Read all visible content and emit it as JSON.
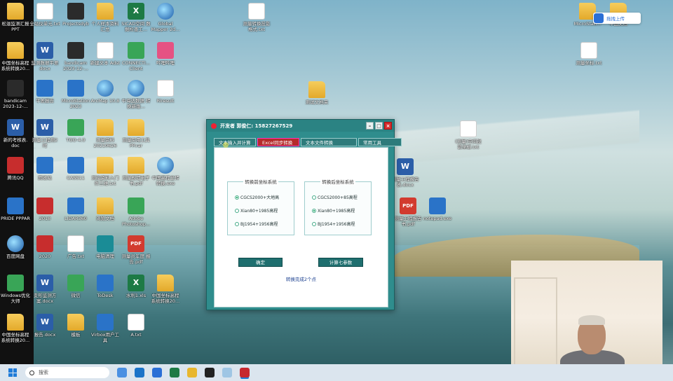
{
  "desktop": {
    "icons": [
      {
        "label": "松滋监测汇报 PPT",
        "kind": "folder"
      },
      {
        "label": "中国坐标高程 系统转换20...",
        "kind": "folder"
      },
      {
        "label": "bandicam 2023-12-...",
        "kind": "dark"
      },
      {
        "label": "新的考核表. doc",
        "kind": "word"
      },
      {
        "label": "腾讯QQ",
        "kind": "red"
      },
      {
        "label": "PRIDE PPPAR",
        "kind": "blue"
      },
      {
        "label": "百度网盘",
        "kind": "globe"
      },
      {
        "label": "Windows优化大师",
        "kind": "green"
      },
      {
        "label": "中国坐标高程 系统转换20...",
        "kind": "folder"
      },
      {
        "label": "全站仪单元.txt",
        "kind": "doc"
      },
      {
        "label": "监测数据平差 docx",
        "kind": "word"
      },
      {
        "label": "平差报告",
        "kind": "blue"
      },
      {
        "label": "测量工程测2 时间.213.docx",
        "kind": "word"
      },
      {
        "label": "回收站",
        "kind": "blue"
      },
      {
        "label": "2018",
        "kind": "red"
      },
      {
        "label": "2020",
        "kind": "red"
      },
      {
        "label": "变形监测方 案.docx",
        "kind": "word"
      },
      {
        "label": "报告.docx",
        "kind": "word"
      },
      {
        "label": "Projectsdyb",
        "kind": "dark"
      },
      {
        "label": "bandicam 2023-12-...",
        "kind": "dark"
      },
      {
        "label": "MicroStation 2023",
        "kind": "blue"
      },
      {
        "label": "TGO-4.0",
        "kind": "green"
      },
      {
        "label": "CASS11",
        "kind": "blue"
      },
      {
        "label": "LIDAR360",
        "kind": "blue"
      },
      {
        "label": "广告.txt",
        "kind": "doc"
      },
      {
        "label": "微信",
        "kind": "green"
      },
      {
        "label": "模板",
        "kind": "folder"
      },
      {
        "label": "个人样本资料 汇总",
        "kind": "folder"
      },
      {
        "label": "新建文本 Adst",
        "kind": "doc"
      },
      {
        "label": "ArcMap 10.8",
        "kind": "globe"
      },
      {
        "label": "测量资料 20210626",
        "kind": "folder"
      },
      {
        "label": "测绘资料入门 件三维.txt",
        "kind": "folder"
      },
      {
        "label": "浏览文档",
        "kind": "folder"
      },
      {
        "label": "电脑清理",
        "kind": "teal"
      },
      {
        "label": "ToDesk",
        "kind": "blue"
      },
      {
        "label": "Virbox用户工 具",
        "kind": "blue"
      },
      {
        "label": "SICAD空间 数据检查工...",
        "kind": "excel"
      },
      {
        "label": "CONNECTI... Client",
        "kind": "green"
      },
      {
        "label": "中海达数据 转换新版...",
        "kind": "globe"
      },
      {
        "label": "测量实用工具 PP.rar",
        "kind": "folder"
      },
      {
        "label": "测量规范电子 书.pdf",
        "kind": "folder"
      },
      {
        "label": "Adobe Photoshop...",
        "kind": "green"
      },
      {
        "label": "测量员年度 报告.pdf",
        "kind": "pdf"
      },
      {
        "label": "水利1.xls",
        "kind": "excel"
      },
      {
        "label": "A.txt",
        "kind": "doc"
      },
      {
        "label": "Global Mapper 2d...",
        "kind": "globe"
      },
      {
        "label": "哔哩哔哩",
        "kind": "pink"
      },
      {
        "label": "Riresult",
        "kind": "doc"
      },
      {
        "label": "中国高程全转 转换.exe",
        "kind": "globe"
      },
      {
        "label": "中国坐标高程 系统转换20...",
        "kind": "folder"
      },
      {
        "label": "测量转换投影 格式.txt",
        "kind": "doc"
      },
      {
        "label": "测试文档夹",
        "kind": "folder"
      },
      {
        "label": "(测量)空间投 影坐标.txt",
        "kind": "doc"
      },
      {
        "label": "测量工程报告 表.docx",
        "kind": "word"
      },
      {
        "label": "测量工程报告 书.pdf",
        "kind": "pdf"
      },
      {
        "label": "notepad.exe",
        "kind": "blue"
      },
      {
        "label": "MicroStati...",
        "kind": "folder"
      },
      {
        "label": "中国文档",
        "kind": "folder"
      },
      {
        "label": "测量坐标.txt",
        "kind": "doc"
      }
    ]
  },
  "upload_widget": {
    "label": "拖拽上传"
  },
  "app": {
    "title": "开发者 郭俊仁: 15827267529",
    "tabs": [
      "文本输入并计算",
      "Excel同步转换",
      "文本文件转换",
      "常用工具"
    ],
    "before_group": {
      "title": "转换前坐标系统",
      "options": [
        "CGCS2000+大地高",
        "Xian80+1985高程",
        "BJ1954+1956高程"
      ],
      "selected": 0
    },
    "after_group": {
      "title": "转换后坐标系统",
      "options": [
        "CGCS2000+85高程",
        "Xian80+1985高程",
        "BJ1954+1956高程"
      ],
      "selected": 1
    },
    "ok_button": "确定",
    "seven_param_button": "计算七参数",
    "status": "转换完成2个点"
  },
  "taskbar": {
    "search_placeholder": "搜索"
  }
}
